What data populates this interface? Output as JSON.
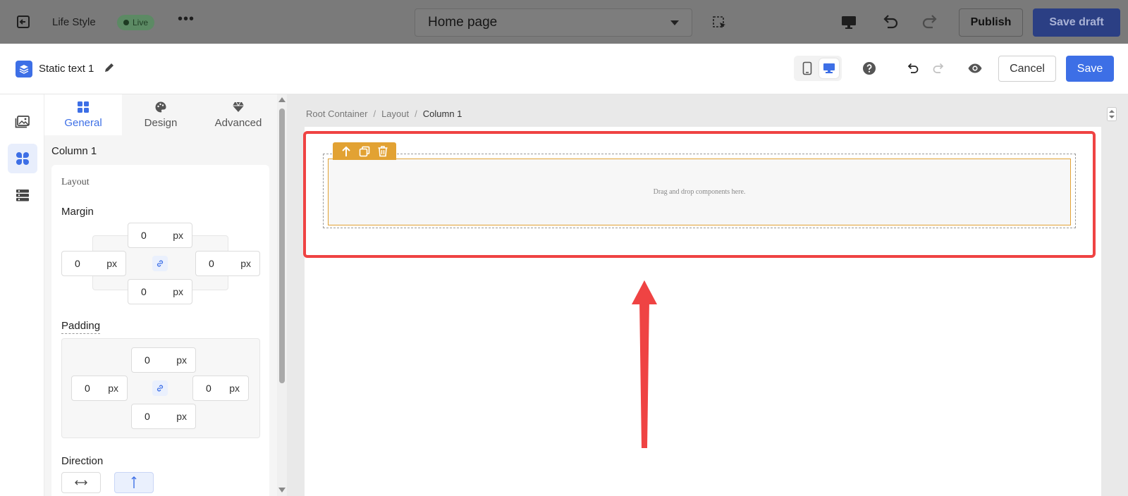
{
  "topbar": {
    "site_name": "Life Style",
    "live_badge": "Live",
    "more": "•••",
    "page_select": "Home page",
    "publish_label": "Publish",
    "save_draft_label": "Save draft"
  },
  "editor": {
    "component_title": "Static text 1",
    "cancel_label": "Cancel",
    "save_label": "Save"
  },
  "panel": {
    "tabs": [
      {
        "label": "General",
        "icon": "grid-icon",
        "active": true
      },
      {
        "label": "Design",
        "icon": "palette-icon",
        "active": false
      },
      {
        "label": "Advanced",
        "icon": "diamond-icon",
        "active": false
      }
    ],
    "title": "Column 1",
    "section": "Layout",
    "margin": {
      "label": "Margin",
      "top": "0",
      "left": "0",
      "right": "0",
      "bottom": "0",
      "unit": "px"
    },
    "padding": {
      "label": "Padding",
      "top": "0",
      "left": "0",
      "right": "0",
      "bottom": "0",
      "unit": "px"
    },
    "direction_label": "Direction"
  },
  "canvas": {
    "breadcrumb": [
      "Root Container",
      "Layout",
      "Column 1"
    ],
    "separator": "/",
    "placeholder": "Drag and drop components here."
  },
  "colors": {
    "accent": "#3d6fe6",
    "highlight": "#ef4343",
    "column_border": "#e2a233",
    "save_draft": "#2b3f84"
  }
}
